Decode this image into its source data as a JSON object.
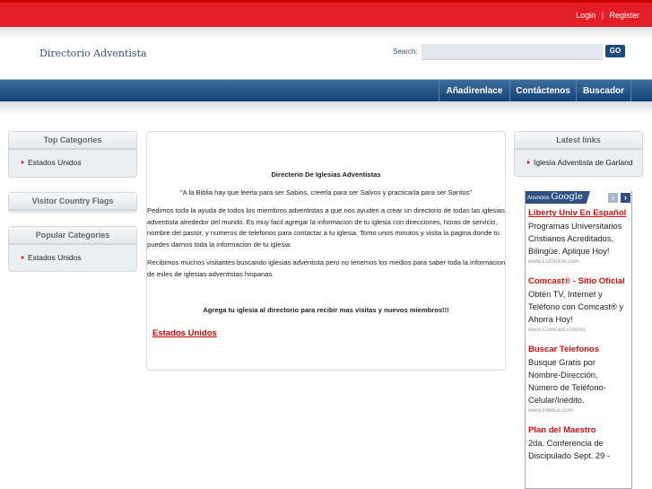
{
  "top": {
    "login": "Login",
    "sep": "|",
    "register": "Register"
  },
  "header": {
    "logo": "Directorio Adventista",
    "search_label": "Search:",
    "search_value": "",
    "go": "GO"
  },
  "nav": [
    "Añadirenlace",
    "Contáctenos",
    "Buscador"
  ],
  "left": {
    "top_categories": {
      "title": "Top Categories",
      "items": [
        "Estados Unidos"
      ]
    },
    "flags": {
      "title": "Visitor Country Flags"
    },
    "popular": {
      "title": "Popular Categories",
      "items": [
        "Estados Unidos"
      ]
    }
  },
  "center": {
    "title": "Directerio De Iglesias Adventistas",
    "quote": "\"A la Biblia hay que leerla para ser Sabios, creerla para ser Salvos y practicarla para ser Santos\"",
    "p1": "Pedimos toda la ayuda de todos los miembros adventistas a que nos ayuden a crear un directorio de todas las iglesias adventista alrededor del mundo. Es muy facil agregar la informacion de tu iglesia con direcciones, horas de servicio, nombre del pastor, y numeros de telefonos para contactar a tu iglesia. Tomo unos minutos y visita la pagina donde tu puedes darnos toda la informacion de tu iglesia.",
    "p2": "Recibimos muchos visitantes buscando iglesias adventista pero no tenemos los medios para saber toda la informacion de miles de iglesias adventistas hispanas.",
    "cta": "Agrega tu iglesia al directorio para recibir mas visitas y nuevos miembros!!!",
    "link": "Estados Unidos"
  },
  "right": {
    "latest": {
      "title": "Latest links",
      "items": [
        "Iglesia Adventista de Garland"
      ]
    }
  },
  "ads": {
    "label": "Anuncios",
    "brand": "Google",
    "items": [
      {
        "title": "Liberty Univ En Español",
        "text": "Programas Universitarios Cristianos Acreditados, Bilingüe. Aplique Hoy!",
        "url": "www.LUOnline.com"
      },
      {
        "title": "Comcast® - Sitio Oficial",
        "text": "Obtén TV, Internet y Teléfono con Comcast® y Ahorra Hoy!",
        "url": "www.Comcast.com/es"
      },
      {
        "title": "Buscar Telefonos",
        "text": "Busque Gratis por Nombre-Dirección, Número de Teléfono-Celular/Inédito.",
        "url": "www.Intelius.com"
      },
      {
        "title": "Plan del Maestro",
        "text": "2da. Conferencia de Discipulado Sept. 29 -",
        "url": ""
      }
    ]
  }
}
